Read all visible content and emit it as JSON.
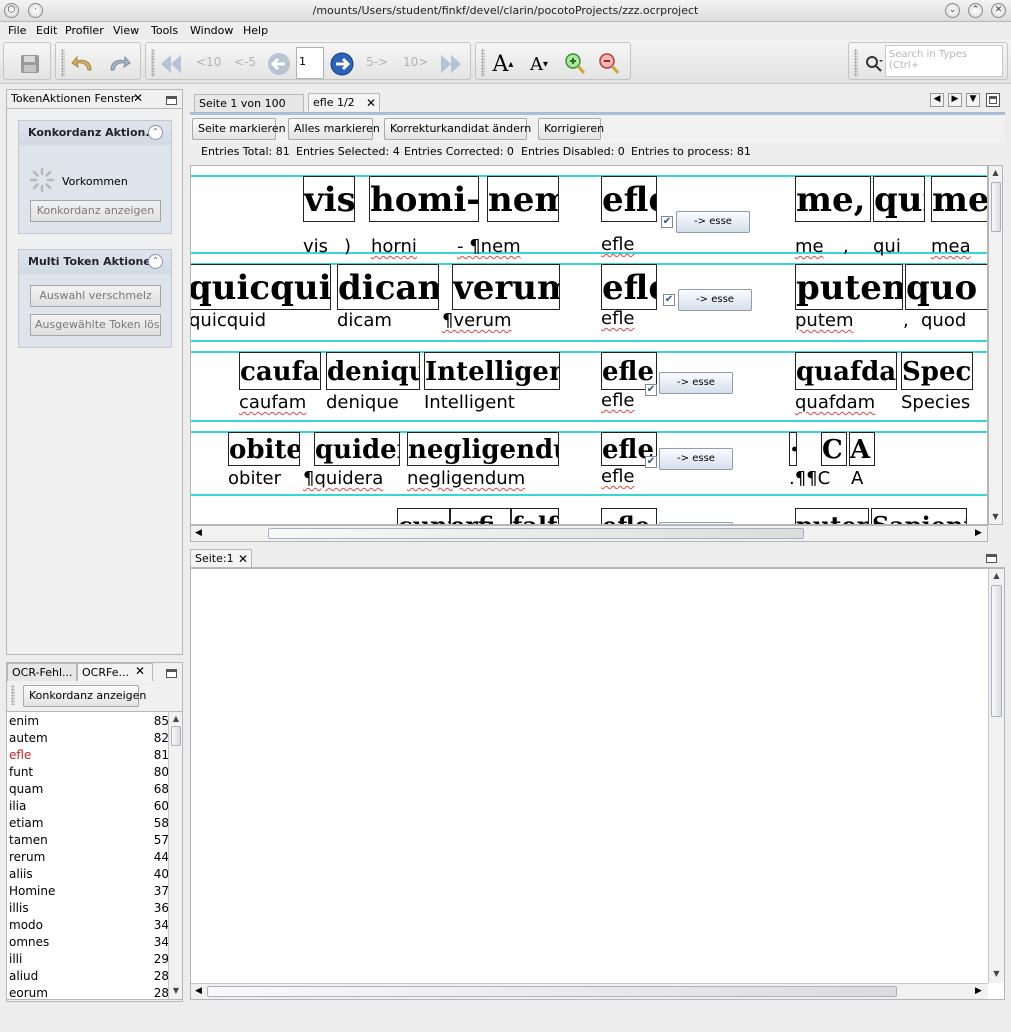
{
  "window": {
    "title": "/mounts/Users/student/finkf/devel/clarin/pocotoProjects/zzz.ocrproject"
  },
  "menu": [
    "File",
    "Edit",
    "Profiler",
    "View",
    "Tools",
    "Window",
    "Help"
  ],
  "toolbar": {
    "nav_back10": "<10",
    "nav_back5": "<-5",
    "page_value": "1",
    "nav_fwd5": "5->",
    "nav_fwd10": "10>",
    "search_placeholder": "Search in Types (Ctrl+"
  },
  "left_panel": {
    "title": "TokenAktionen Fenster",
    "konkordanz": {
      "title": "Konkordanz Aktion...",
      "vorkommen": "Vorkommen",
      "button": "Konkordanz anzeigen"
    },
    "multi": {
      "title": "Multi Token Aktionen",
      "button1": "Auswahl verschmelz",
      "button2": "Ausgewählte Token lösc"
    }
  },
  "bottom_left": {
    "tabs": [
      "OCR-Fehl...",
      "OCRFe..."
    ],
    "button": "Konkordanz anzeigen",
    "words": [
      {
        "w": "enim",
        "c": "85"
      },
      {
        "w": "autem",
        "c": "82"
      },
      {
        "w": "efle",
        "c": "81",
        "highlight": true
      },
      {
        "w": "funt",
        "c": "80"
      },
      {
        "w": "quam",
        "c": "68"
      },
      {
        "w": "ilia",
        "c": "60"
      },
      {
        "w": "etiam",
        "c": "58"
      },
      {
        "w": "tamen",
        "c": "57"
      },
      {
        "w": "rerum",
        "c": "44"
      },
      {
        "w": "aliis",
        "c": "40"
      },
      {
        "w": "Homine",
        "c": "37"
      },
      {
        "w": "illis",
        "c": "36"
      },
      {
        "w": "modo",
        "c": "34"
      },
      {
        "w": "omnes",
        "c": "34"
      },
      {
        "w": "illi",
        "c": "29"
      },
      {
        "w": "aliud",
        "c": "28"
      },
      {
        "w": "eorum",
        "c": "28"
      }
    ],
    "highlight_color": "#cc2222"
  },
  "tabs": [
    "Seite 1 von 100",
    "efle 1/2"
  ],
  "actions": {
    "seite": "Seite markieren",
    "alles": "Alles markieren",
    "korrektur": "Korrekturkandidat ändern",
    "korrigieren": "Korrigieren"
  },
  "stats": {
    "total": "Entries Total: 81",
    "selected": "Entries Selected: 4",
    "corrected": "Entries Corrected: 0",
    "disabled": "Entries Disabled: 0",
    "process": "Entries to process: 81"
  },
  "concordance": {
    "esse_label": "-> esse",
    "rows": [
      {
        "img_left": [
          "vis)",
          "homi-",
          "nem"
        ],
        "ocr_left": [
          "vis",
          ")",
          "horni",
          "- ¶nem"
        ],
        "token_img": "efle",
        "token_ocr": "efle",
        "img_right": [
          "me,",
          "qui",
          "mea"
        ],
        "ocr_right": [
          "me",
          ",",
          "qui",
          "mea"
        ]
      },
      {
        "img_left": [
          "quicquid",
          "dicam",
          "verum"
        ],
        "ocr_left": [
          "quicquid",
          "dicam",
          "¶verum"
        ],
        "token_img": "efle",
        "token_ocr": "efle",
        "img_right": [
          "putem,",
          "quo"
        ],
        "ocr_right": [
          "putem",
          ",",
          "quod"
        ]
      },
      {
        "img_left": [
          "caufam",
          "denique",
          "Intelligendi"
        ],
        "ocr_left": [
          "caufam",
          "denique",
          "Intelligent"
        ],
        "token_img": "efle",
        "token_ocr": "efle",
        "img_right": [
          "quafdam",
          "Species"
        ],
        "ocr_right": [
          "quafdam",
          "Species"
        ]
      },
      {
        "img_left": [
          "obiter",
          "quidem",
          "negligendum"
        ],
        "ocr_left": [
          "obiter",
          "¶quidera",
          "negligendum"
        ],
        "token_img": "efle",
        "token_ocr": "efle",
        "img_right": [
          "·",
          "C",
          "A"
        ],
        "ocr_right": [
          ".¶¶C",
          "A"
        ]
      },
      {
        "img_left": [
          "cunt",
          "erfi",
          "falfa"
        ],
        "token_img": "efle",
        "img_right": [
          "putent",
          "Sapienti"
        ]
      }
    ]
  },
  "lower_tab": "Seite:1",
  "colors": {
    "accent_line": "#38d6d6",
    "nav_blue": "#2c62b8"
  }
}
